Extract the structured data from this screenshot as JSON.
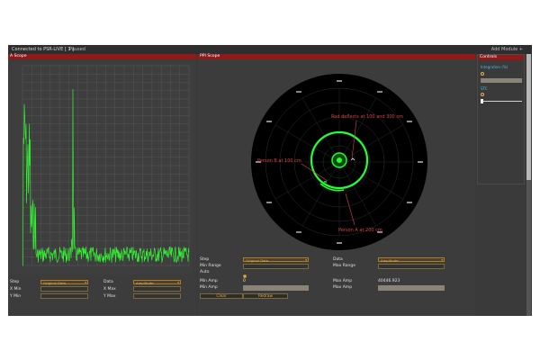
{
  "topbar": {
    "connection": "Connected to PSR-LIVE [ 1 ]",
    "state": "Paused",
    "add_module": "Add Module +"
  },
  "ascope": {
    "title": "A Scope",
    "step_label": "Step",
    "step_value": "Original Data",
    "data_label": "Data",
    "data_value": "Amplitude",
    "xmin_label": "X Min",
    "xmax_label": "X Max",
    "ymin_label": "Y Min",
    "ymax_label": "Y Max"
  },
  "ppi": {
    "title": "PPI Scope",
    "step_label": "Step",
    "step_value": "Original Data",
    "data_label": "Data",
    "data_value": "Amplitude",
    "min_range_label": "Min Range",
    "max_range_label": "Max Range",
    "auto_label": "Auto",
    "min_amp_label": "Min Amp",
    "min_amp_value": "0",
    "max_amp_label": "Max Amp",
    "max_amp_value": "40446.923",
    "min_amp2_label": "Min Amp",
    "max_amp2_label": "Max Amp",
    "clear_label": "Clear",
    "redraw_label": "Redraw",
    "annotations": {
      "top": "Rod deflects at 100 and 300 cm",
      "left": "Person B at 100 cm",
      "bottom": "Person A at 200 cm"
    }
  },
  "controls": {
    "title": "Controls",
    "param1_label": "Integration (%)",
    "param2_label": "STC"
  },
  "colors": {
    "panel_header": "#8e1a1a",
    "accent": "#e6b04a",
    "trace": "#33ee33"
  }
}
